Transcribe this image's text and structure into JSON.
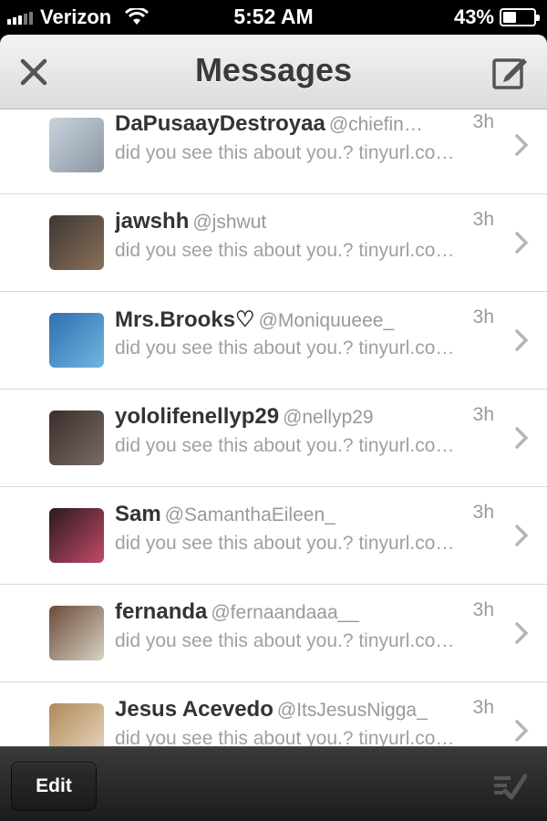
{
  "status_bar": {
    "carrier": "Verizon",
    "time": "5:52 AM",
    "battery": "43%",
    "battery_level": 0.43
  },
  "nav": {
    "title": "Messages",
    "close_icon": "close-icon",
    "compose_icon": "compose-icon"
  },
  "messages": [
    {
      "name": "DaPusaayDestroyaa",
      "handle": "@chiefin…",
      "time": "3h",
      "preview": "did you see this about you.? tinyurl.co…",
      "avatar_colors": [
        "#c9d3dc",
        "#8a96a3"
      ]
    },
    {
      "name": "jawshh",
      "handle": "@jshwut",
      "time": "3h",
      "preview": "did you see this about you.? tinyurl.co…",
      "avatar_colors": [
        "#3c3834",
        "#8a7058"
      ]
    },
    {
      "name": "Mrs.Brooks♡",
      "handle": "@Moniquueee_",
      "time": "3h",
      "preview": "did you see this about you.? tinyurl.co…",
      "avatar_colors": [
        "#2f6fb0",
        "#6fb7e0"
      ]
    },
    {
      "name": "yololifenellyp29",
      "handle": "@nellyp29",
      "time": "3h",
      "preview": "did you see this about you.? tinyurl.co…",
      "avatar_colors": [
        "#3b2e2a",
        "#7a6a66"
      ]
    },
    {
      "name": "Sam",
      "handle": "@SamanthaEileen_",
      "time": "3h",
      "preview": "did you see this about you.? tinyurl.co…",
      "avatar_colors": [
        "#2a1a1c",
        "#c24a6a"
      ]
    },
    {
      "name": "fernanda",
      "handle": "@fernaandaaa__",
      "time": "3h",
      "preview": "did you see this about you.? tinyurl.co…",
      "avatar_colors": [
        "#6b4a3a",
        "#d8d1c2"
      ]
    },
    {
      "name": "Jesus Acevedo",
      "handle": "@ItsJesusNigga_",
      "time": "3h",
      "preview": "did you see this about you.? tinyurl.co…",
      "avatar_colors": [
        "#b08a5a",
        "#e8d8c0"
      ]
    }
  ],
  "toolbar": {
    "edit_label": "Edit",
    "check_icon": "checkmark-list-icon"
  }
}
